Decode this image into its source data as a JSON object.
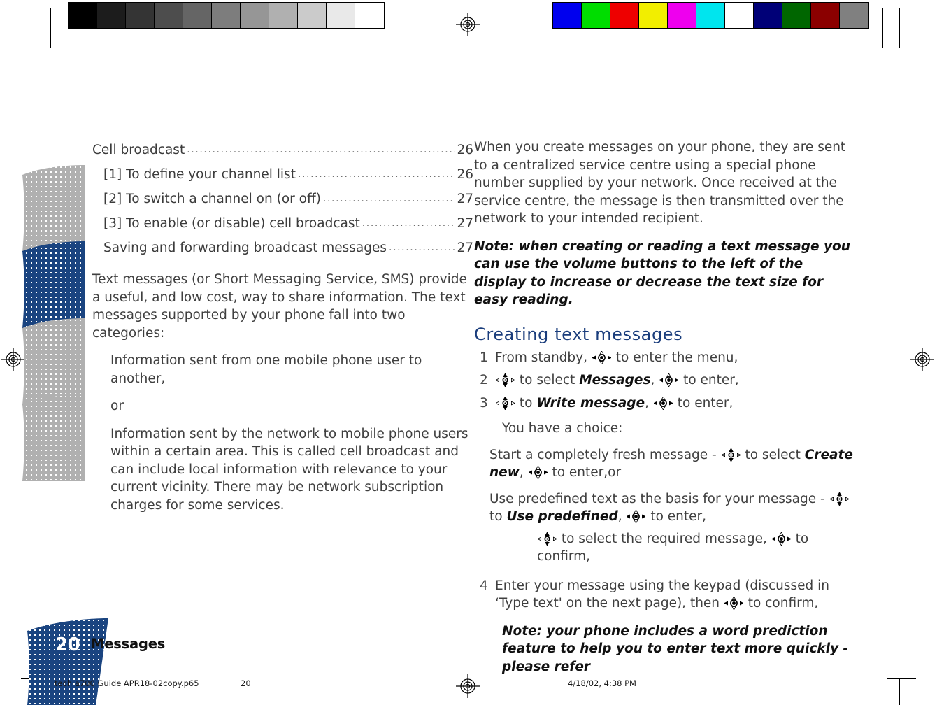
{
  "prepress": {
    "gray_strip_name": "grayscale-calibration-strip",
    "gray_patches": [
      "#000000",
      "#1c1c1c",
      "#343434",
      "#4d4d4d",
      "#656565",
      "#7d7d7d",
      "#969696",
      "#b0b0b0",
      "#cbcbcb",
      "#e9e9e9",
      "#ffffff"
    ],
    "color_strip_name": "color-calibration-strip",
    "color_patches": [
      "#0000ee",
      "#00dd00",
      "#ee0000",
      "#f2ee00",
      "#ee00ee",
      "#00e5ee",
      "#ffffff",
      "#000077",
      "#006600",
      "#8b0000",
      "#808080"
    ]
  },
  "toc": {
    "entries": [
      {
        "label": "Cell broadcast",
        "page": "26",
        "level": 0
      },
      {
        "label": "[1] To define your channel list",
        "page": "26",
        "level": 1
      },
      {
        "label": "[2] To switch a channel on (or off)",
        "page": "27",
        "level": 1
      },
      {
        "label": "[3] To enable (or disable) cell broadcast",
        "page": "27",
        "level": 1
      },
      {
        "label": "Saving and forwarding broadcast messages",
        "page": "27",
        "level": 1
      }
    ],
    "dot_leader": "............................................................................................................"
  },
  "left_column": {
    "intro": "Text messages (or Short Messaging Service, SMS) provide a useful, and low cost, way to share information. The text messages supported by your phone fall into two categories:",
    "bullet_one": "Information sent from one mobile phone user to another,",
    "bullet_or": "or",
    "bullet_two": "Information sent by the network to mobile phone users within a certain area. This is called cell broadcast and can include local information with relevance to your current vicinity. There may be network subscription charges for some services."
  },
  "right_column": {
    "intro": "When you create messages on your phone, they are sent to a centralized service centre using a special phone number supplied by your network. Once received at the service centre, the message is then transmitted over the network to your intended recipient.",
    "note_volume": "Note: when creating or reading a text message you can use the volume buttons to the left of the display to increase or decrease the text size for easy reading.",
    "heading": "Creating text messages",
    "steps": [
      {
        "num": "1",
        "parts": [
          {
            "t": "text",
            "v": "From standby, "
          },
          {
            "t": "icon",
            "v": "nav-key-enter-icon"
          },
          {
            "t": "text",
            "v": " to enter the menu,"
          }
        ]
      },
      {
        "num": "2",
        "parts": [
          {
            "t": "icon",
            "v": "nav-key-updown-icon"
          },
          {
            "t": "text",
            "v": " to select "
          },
          {
            "t": "bold",
            "v": "Messages"
          },
          {
            "t": "text",
            "v": ", "
          },
          {
            "t": "icon",
            "v": "nav-key-enter-icon"
          },
          {
            "t": "text",
            "v": " to enter,"
          }
        ]
      },
      {
        "num": "3",
        "parts": [
          {
            "t": "icon",
            "v": "nav-key-updown-icon"
          },
          {
            "t": "text",
            "v": " to "
          },
          {
            "t": "bold",
            "v": "Write message"
          },
          {
            "t": "text",
            "v": ",  "
          },
          {
            "t": "icon",
            "v": "nav-key-enter-icon"
          },
          {
            "t": "text",
            "v": " to enter,"
          }
        ]
      }
    ],
    "choice_lead": "You have a choice:",
    "choice_one": [
      {
        "t": "text",
        "v": "Start a completely fresh message - "
      },
      {
        "t": "icon",
        "v": "nav-key-updown-icon"
      },
      {
        "t": "text",
        "v": " to select "
      },
      {
        "t": "bold",
        "v": "Create new"
      },
      {
        "t": "text",
        "v": ",  "
      },
      {
        "t": "icon",
        "v": "nav-key-enter-icon"
      },
      {
        "t": "text",
        "v": " to enter,or"
      }
    ],
    "choice_two": [
      {
        "t": "text",
        "v": "Use predefined text as the basis for your message - "
      },
      {
        "t": "icon",
        "v": "nav-key-updown-icon"
      },
      {
        "t": "text",
        "v": " to "
      },
      {
        "t": "bold",
        "v": "Use predefined"
      },
      {
        "t": "text",
        "v": ", "
      },
      {
        "t": "icon",
        "v": "nav-key-enter-icon"
      },
      {
        "t": "text",
        "v": " to enter,"
      }
    ],
    "choice_two_sub": [
      {
        "t": "icon",
        "v": "nav-key-updown-icon"
      },
      {
        "t": "text",
        "v": "  to select the required message, "
      },
      {
        "t": "icon",
        "v": "nav-key-enter-icon"
      },
      {
        "t": "text",
        "v": " to confirm,"
      }
    ],
    "step_four": {
      "num": "4",
      "parts": [
        {
          "t": "text",
          "v": "Enter your message using the keypad (discussed in ‘Type text' on the next page), then "
        },
        {
          "t": "icon",
          "v": "nav-key-enter-icon"
        },
        {
          "t": "text",
          "v": " to confirm,"
        }
      ]
    },
    "note_prediction": "Note: your phone includes a word prediction feature to help you to enter text more quickly - please refer"
  },
  "thumb_tabs": [
    {
      "name": "thumb-tab-1",
      "color": "#b0b0b0",
      "active": false
    },
    {
      "name": "thumb-tab-messages",
      "color": "#1a4480",
      "active": true
    },
    {
      "name": "thumb-tab-3",
      "color": "#b0b0b0",
      "active": false
    },
    {
      "name": "thumb-tab-4",
      "color": "#b0b0b0",
      "active": false
    }
  ],
  "page_tab": {
    "number": "20",
    "chapter": "Messages",
    "color": "#1a4480"
  },
  "footer": {
    "file": "tech a700 Guide APR18-02copy.p65",
    "page": "20",
    "date": "4/18/02, 4:38 PM",
    "regmark_name": "registration-mark"
  },
  "colors": {
    "heading": "#1a3d7c",
    "brand_navy": "#1a4480",
    "body_text": "#3f3f3f"
  }
}
